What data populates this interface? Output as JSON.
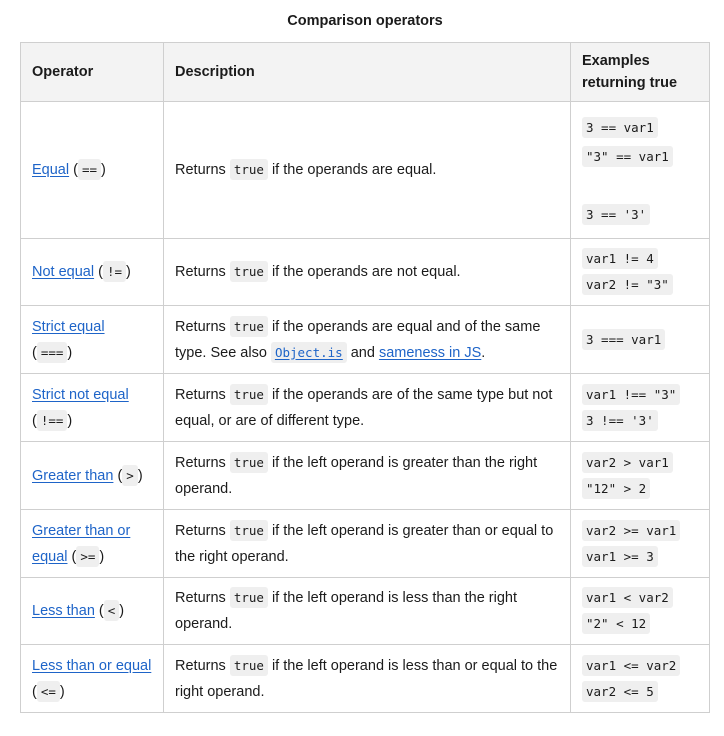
{
  "table": {
    "caption": "Comparison operators",
    "headers": {
      "operator": "Operator",
      "description": "Description",
      "examples": "Examples returning true"
    },
    "rows": [
      {
        "name": "Equal",
        "symbol": "==",
        "desc_pre": "Returns",
        "desc_code": "true",
        "desc_post": "if the operands are equal.",
        "examples": [
          "3 == var1",
          "\"3\" == var1",
          "3 == '3'"
        ]
      },
      {
        "name": "Not equal",
        "symbol": "!=",
        "desc_pre": "Returns",
        "desc_code": "true",
        "desc_post": "if the operands are not equal.",
        "examples": [
          "var1 != 4",
          "var2 != \"3\""
        ]
      },
      {
        "name": "Strict equal",
        "symbol": "===",
        "desc_pre": "Returns",
        "desc_code": "true",
        "desc_post": "if the operands are equal and of the same type. See also",
        "desc_link_code": "Object.is",
        "desc_and": "and",
        "desc_link": "sameness in JS",
        "desc_end": ".",
        "examples": [
          "3 === var1"
        ]
      },
      {
        "name": "Strict not equal",
        "symbol": "!==",
        "desc_pre": "Returns",
        "desc_code": "true",
        "desc_post": "if the operands are of the same type but not equal, or are of different type.",
        "examples": [
          "var1 !== \"3\"",
          "3 !== '3'"
        ]
      },
      {
        "name": "Greater than",
        "symbol": ">",
        "desc_pre": "Returns",
        "desc_code": "true",
        "desc_post": "if the left operand is greater than the right operand.",
        "examples": [
          "var2 > var1",
          "\"12\" > 2"
        ]
      },
      {
        "name": "Greater than or equal",
        "symbol": ">=",
        "desc_pre": "Returns",
        "desc_code": "true",
        "desc_post": "if the left operand is greater than or equal to the right operand.",
        "examples": [
          "var2 >= var1",
          "var1 >= 3"
        ]
      },
      {
        "name": "Less than",
        "symbol": "<",
        "desc_pre": "Returns",
        "desc_code": "true",
        "desc_post": "if the left operand is less than the right operand.",
        "examples": [
          "var1 < var2",
          "\"2\" < 12"
        ]
      },
      {
        "name": "Less than or equal",
        "symbol": "<=",
        "desc_pre": "Returns",
        "desc_code": "true",
        "desc_post": "if the left operand is less than or equal to the right operand.",
        "examples": [
          "var1 <= var2",
          "var2 <= 5"
        ]
      }
    ]
  }
}
